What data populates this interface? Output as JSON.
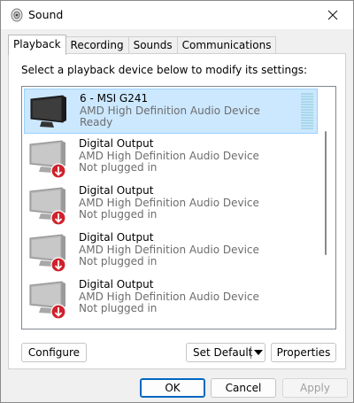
{
  "window": {
    "title": "Sound",
    "icon": "speaker-icon"
  },
  "tabs": [
    {
      "label": "Playback",
      "active": true
    },
    {
      "label": "Recording",
      "active": false
    },
    {
      "label": "Sounds",
      "active": false
    },
    {
      "label": "Communications",
      "active": false
    }
  ],
  "instruction": "Select a playback device below to modify its settings:",
  "devices": [
    {
      "name": "6 - MSI G241",
      "driver": "AMD High Definition Audio Device",
      "status": "Ready",
      "selected": true,
      "icon": "monitor-icon"
    },
    {
      "name": "Digital Output",
      "driver": "AMD High Definition Audio Device",
      "status": "Not plugged in",
      "selected": false,
      "icon": "monitor-unplugged-icon"
    },
    {
      "name": "Digital Output",
      "driver": "AMD High Definition Audio Device",
      "status": "Not plugged in",
      "selected": false,
      "icon": "monitor-unplugged-icon"
    },
    {
      "name": "Digital Output",
      "driver": "AMD High Definition Audio Device",
      "status": "Not plugged in",
      "selected": false,
      "icon": "monitor-unplugged-icon"
    },
    {
      "name": "Digital Output",
      "driver": "AMD High Definition Audio Device",
      "status": "Not plugged in",
      "selected": false,
      "icon": "monitor-unplugged-icon"
    }
  ],
  "buttons": {
    "configure": "Configure",
    "set_default": "Set Default",
    "properties": "Properties",
    "ok": "OK",
    "cancel": "Cancel",
    "apply": "Apply"
  },
  "colors": {
    "selection_bg": "#cce8ff",
    "selection_border": "#99d1ff",
    "unplugged_badge": "#d0212c",
    "primary_border": "#0067c0"
  }
}
